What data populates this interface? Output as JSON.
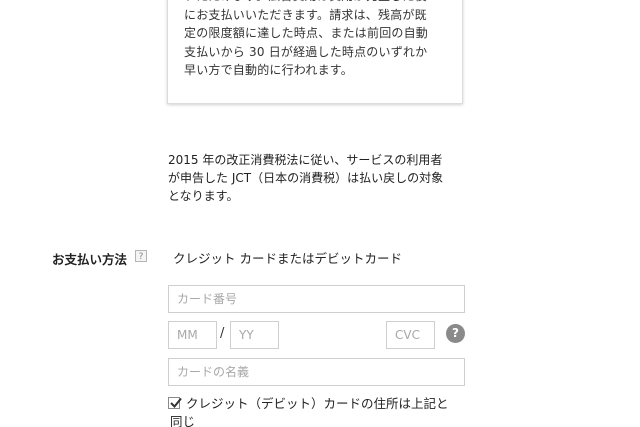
{
  "info_box": {
    "text": "いただけます。広告費用は費用が発生した後\nにお支払いいただきます。請求は、残高が既\n定の限度額に達した時点、または前回の自動\n支払いから 30 日が経過した時点のいずれか\n早い方で自動的に行われます。"
  },
  "tax_note": "2015 年の改正消費税法に従い、サービスの利用者\nが申告した JCT（日本の消費税）は払い戻しの対象\nとなります。",
  "payment": {
    "label": "お支払い方法",
    "help_badge": "?",
    "method": "クレジット カードまたはデビットカード",
    "card_number_placeholder": "カード番号",
    "month_placeholder": "MM",
    "date_separator": "/",
    "year_placeholder": "YY",
    "cvc_placeholder": "CVC",
    "cvc_help": "?",
    "card_name_placeholder": "カードの名義",
    "same_address_label_line1": "クレジット（デビット）カードの住所は上記と",
    "same_address_label_line2": "同じ",
    "same_address_checked": true
  },
  "icons": {
    "help": "question-icon",
    "check": "checkmark-icon"
  }
}
